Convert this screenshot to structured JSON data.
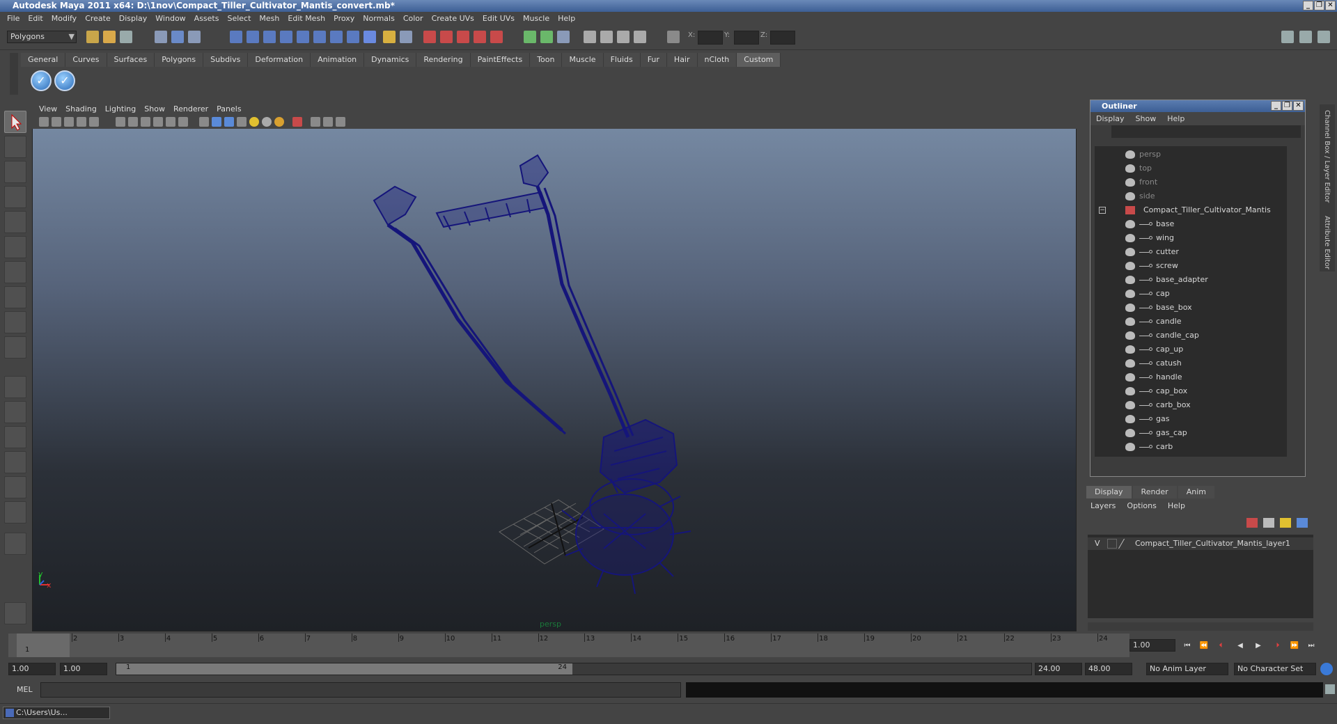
{
  "window": {
    "title": "Autodesk Maya 2011 x64: D:\\1nov\\Compact_Tiller_Cultivator_Mantis_convert.mb*"
  },
  "menubar": [
    "File",
    "Edit",
    "Modify",
    "Create",
    "Display",
    "Window",
    "Assets",
    "Select",
    "Mesh",
    "Edit Mesh",
    "Proxy",
    "Normals",
    "Color",
    "Create UVs",
    "Edit UVs",
    "Muscle",
    "Help"
  ],
  "statusline": {
    "mode": "Polygons",
    "x_label": "X:",
    "y_label": "Y:",
    "z_label": "Z:"
  },
  "shelf": {
    "tabs": [
      "General",
      "Curves",
      "Surfaces",
      "Polygons",
      "Subdivs",
      "Deformation",
      "Animation",
      "Dynamics",
      "Rendering",
      "PaintEffects",
      "Toon",
      "Muscle",
      "Fluids",
      "Fur",
      "Hair",
      "nCloth",
      "Custom"
    ],
    "active_tab": "Custom"
  },
  "viewport": {
    "menu": [
      "View",
      "Shading",
      "Lighting",
      "Show",
      "Renderer",
      "Panels"
    ],
    "camera_label": "persp",
    "axis_x": "x",
    "axis_y": "y"
  },
  "outliner": {
    "title": "Outliner",
    "menu": [
      "Display",
      "Show",
      "Help"
    ],
    "cameras": [
      "persp",
      "top",
      "front",
      "side"
    ],
    "group": "Compact_Tiller_Cultivator_Mantis",
    "children": [
      "base",
      "wing",
      "cutter",
      "screw",
      "base_adapter",
      "cap",
      "base_box",
      "candle",
      "candle_cap",
      "cap_up",
      "catush",
      "handle",
      "cap_box",
      "carb_box",
      "gas",
      "gas_cap",
      "carb"
    ]
  },
  "layer_editor": {
    "tabs": [
      "Display",
      "Render",
      "Anim"
    ],
    "active_tab": "Display",
    "menu": [
      "Layers",
      "Options",
      "Help"
    ],
    "visible_flag": "V",
    "layer_name": "Compact_Tiller_Cultivator_Mantis_layer1"
  },
  "side_tabs": [
    "Channel Box / Layer Editor",
    "Attribute Editor"
  ],
  "timeline": {
    "ticks": [
      "1",
      "2",
      "3",
      "4",
      "5",
      "6",
      "7",
      "8",
      "9",
      "10",
      "11",
      "12",
      "13",
      "14",
      "15",
      "16",
      "17",
      "18",
      "19",
      "20",
      "21",
      "22",
      "23",
      "24"
    ],
    "current_frame": "1.00",
    "current_marker": "1"
  },
  "range": {
    "start": "1.00",
    "inner_start": "1.00",
    "slider_start": "1",
    "slider_end": "24",
    "end": "24.00",
    "out_end": "48.00",
    "anim_layer": "No Anim Layer",
    "character_set": "No Character Set"
  },
  "commandline": {
    "label": "MEL"
  },
  "taskbar": {
    "item": "C:\\Users\\Us..."
  },
  "colors": {
    "wireframe": "#15157a",
    "titlebar": "#3d5f95",
    "panel_bg": "#444444"
  }
}
